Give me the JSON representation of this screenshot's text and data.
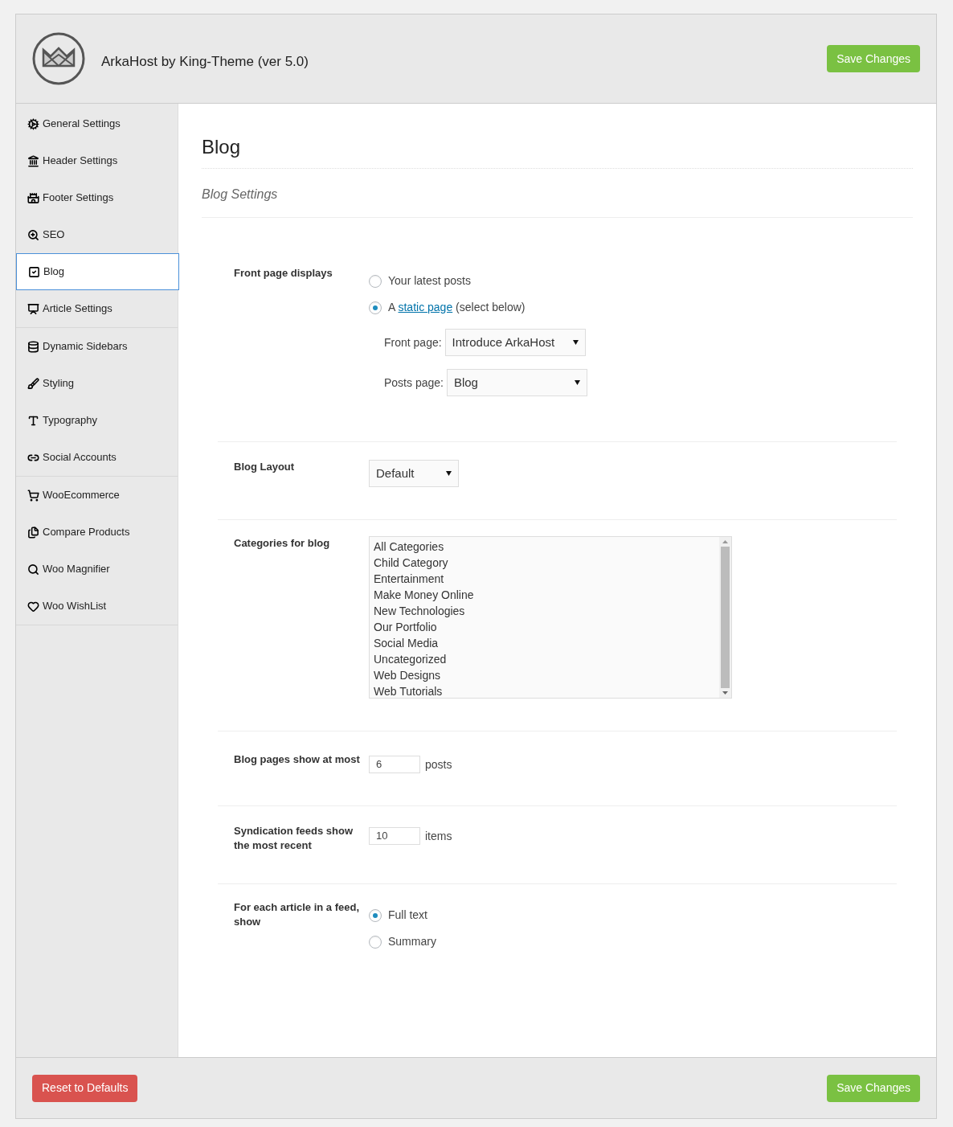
{
  "header": {
    "title": "ArkaHost by King-Theme (ver 5.0)",
    "save_button": "Save Changes"
  },
  "sidebar": {
    "groups": [
      {
        "items": [
          {
            "label": "General Settings",
            "selected": false
          },
          {
            "label": "Header Settings",
            "selected": false
          },
          {
            "label": "Footer Settings",
            "selected": false
          },
          {
            "label": "SEO",
            "selected": false
          },
          {
            "label": "Blog",
            "selected": true
          },
          {
            "label": "Article Settings",
            "selected": false
          }
        ]
      },
      {
        "items": [
          {
            "label": "Dynamic Sidebars",
            "selected": false
          },
          {
            "label": "Styling",
            "selected": false
          },
          {
            "label": "Typography",
            "selected": false
          },
          {
            "label": "Social Accounts",
            "selected": false
          }
        ]
      },
      {
        "items": [
          {
            "label": "WooEcommerce",
            "selected": false
          },
          {
            "label": "Compare Products",
            "selected": false
          },
          {
            "label": "Woo Magnifier",
            "selected": false
          },
          {
            "label": "Woo WishList",
            "selected": false
          }
        ]
      }
    ]
  },
  "content": {
    "title": "Blog",
    "subtitle": "Blog Settings",
    "front_page": {
      "label": "Front page displays",
      "options": [
        {
          "label": "Your latest posts",
          "selected": false
        },
        {
          "link": "static page",
          "before": "A ",
          "after": " (select below)",
          "selected": true
        }
      ],
      "front_select": {
        "label": "Front page:",
        "value": "Introduce ArkaHost"
      },
      "posts_select": {
        "label": "Posts page:",
        "value": "Blog"
      }
    },
    "blog_layout": {
      "label": "Blog Layout",
      "value": "Default"
    },
    "categories": {
      "label": "Categories for blog",
      "options": [
        "All Categories",
        "Child Category",
        "Entertainment",
        "Make Money Online",
        "New Technologies",
        "Our Portfolio",
        "Social Media",
        "Uncategorized",
        "Web Designs",
        "Web Tutorials"
      ]
    },
    "pages_show": {
      "label": "Blog pages show at most",
      "value": "6",
      "unit": "posts"
    },
    "syndication": {
      "label": "Syndication feeds show the most recent",
      "value": "10",
      "unit": "items"
    },
    "feed_show": {
      "label": "For each article in a feed, show",
      "options": [
        {
          "label": "Full text",
          "selected": true
        },
        {
          "label": "Summary",
          "selected": false
        }
      ]
    }
  },
  "footer": {
    "reset_button": "Reset to Defaults",
    "save_button": "Save Changes"
  }
}
